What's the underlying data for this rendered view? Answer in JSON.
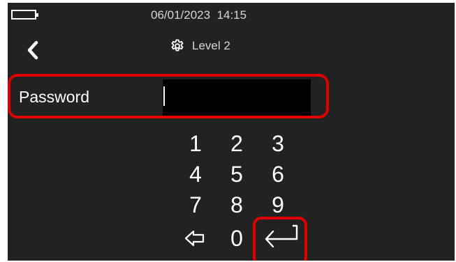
{
  "status_bar": {
    "datetime": "06/01/2023  14:15",
    "battery_icon": "battery-empty-icon"
  },
  "header": {
    "back_icon": "chevron-left-icon",
    "settings_icon": "gear-icon",
    "title": "Level 2"
  },
  "password": {
    "label": "Password",
    "value": ""
  },
  "keypad": {
    "keys": [
      "1",
      "2",
      "3",
      "4",
      "5",
      "6",
      "7",
      "8",
      "9",
      "0"
    ],
    "backspace_icon": "backspace-arrow-left-icon",
    "enter_icon": "enter-return-icon"
  },
  "colors": {
    "screen_background": "#222222",
    "text": "#ffffff",
    "highlight": "#e00000",
    "input_background": "#000000"
  }
}
